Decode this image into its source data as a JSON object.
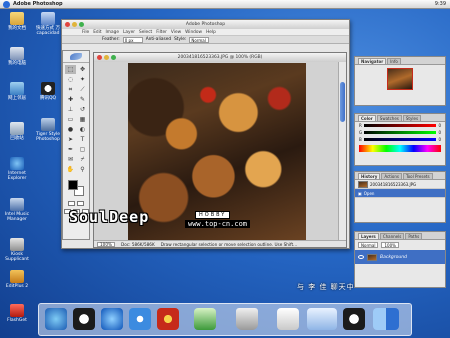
{
  "menubar": {
    "app_name": "Adobe Photoshop",
    "clock": "9:39"
  },
  "desktop_icons": [
    {
      "label": "我的文档",
      "icon": "folder-icon"
    },
    {
      "label": "快速方式 万 capacidad",
      "icon": "shortcut-icon"
    },
    {
      "label": "我的电脑",
      "icon": "computer-icon"
    },
    {
      "label": "网上邻居",
      "icon": "network-icon"
    },
    {
      "label": "回收站",
      "icon": "trash-icon"
    },
    {
      "label": "Internet Explorer",
      "icon": "ie-icon"
    },
    {
      "label": "Intel Music Manager",
      "icon": "music-icon"
    },
    {
      "label": "Kiosk Supplicant",
      "icon": "kiosk-icon"
    },
    {
      "label": "EditPlus 2",
      "icon": "editplus-icon"
    },
    {
      "label": "FlashGet",
      "icon": "flashget-icon"
    },
    {
      "label": "腾讯QQ",
      "icon": "qq-icon"
    },
    {
      "label": "Tiger Style Photoshop",
      "icon": "photoshop-icon"
    }
  ],
  "photoshop": {
    "window_title": "Adobe Photoshop",
    "menu": [
      "File",
      "Edit",
      "Image",
      "Layer",
      "Select",
      "Filter",
      "View",
      "Window",
      "Help"
    ],
    "options": {
      "feather_label": "Feather:",
      "feather_value": "0 px",
      "antialias_label": "Anti-aliased",
      "style_label": "Style:",
      "style_value": "Normal"
    }
  },
  "document": {
    "title": "200341816523363.JPG @ 100% (RGB)",
    "zoom": "100%",
    "doc_info": "Doc: 586K/586K",
    "status_hint": "Draw rectangular selection or move selection outline. Use Shift..."
  },
  "palettes": {
    "navigator": {
      "tabs": [
        "Navigator",
        "Info"
      ]
    },
    "color": {
      "tabs": [
        "Color",
        "Swatches",
        "Styles"
      ],
      "channels": [
        "R",
        "G",
        "B"
      ],
      "values": [
        "0",
        "0",
        "0"
      ]
    },
    "history": {
      "tabs": [
        "History",
        "Actions",
        "Tool Presets"
      ],
      "items": [
        "200341816523363.JPG",
        "Open"
      ]
    },
    "layers": {
      "tabs": [
        "Layers",
        "Channels",
        "Paths"
      ],
      "blend_mode": "Normal",
      "opacity": "100%",
      "layer_name": "Background"
    }
  },
  "watermark": {
    "brand": "SoulDeep",
    "tag": "HOBBY",
    "url": "www.top-cn.com"
  },
  "dock_label": "与 李 佳 聊天中",
  "dock_items": [
    "finder-icon",
    "qq-icon",
    "ie-icon",
    "media-player-icon",
    "qq-penguin-icon",
    "network-icon",
    "trash-icon",
    "apple-icon",
    "chat-window-icon",
    "qq-icon",
    "mac-finder-icon"
  ]
}
